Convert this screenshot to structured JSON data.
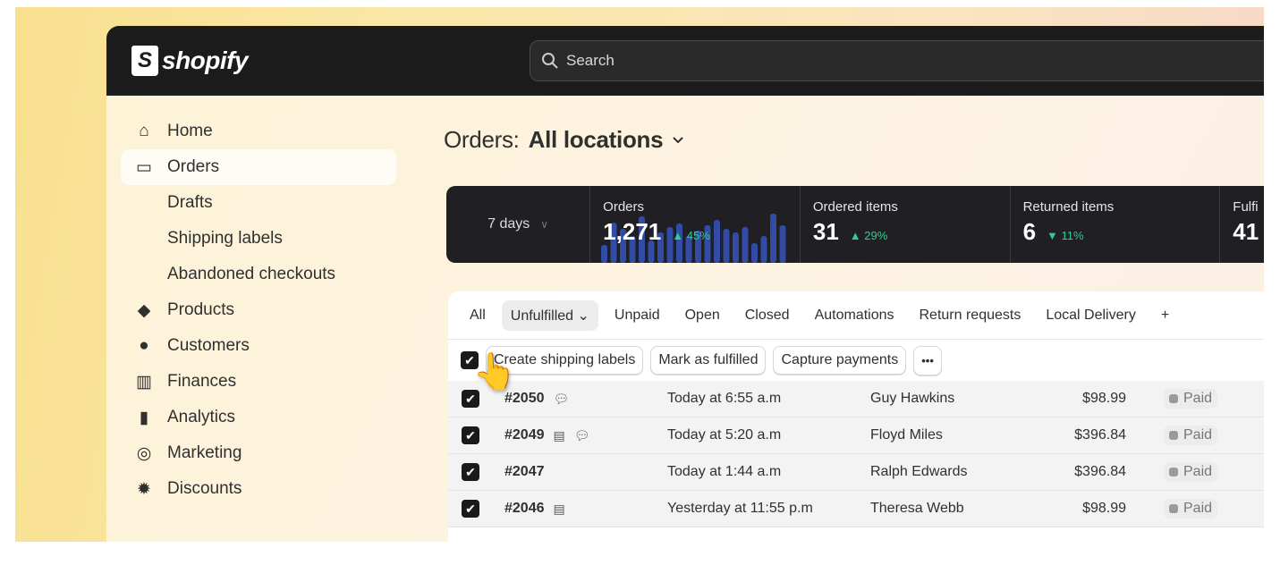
{
  "brand": "shopify",
  "search": {
    "placeholder": "Search"
  },
  "sidebar": {
    "items": [
      {
        "label": "Home",
        "icon": "home-icon"
      },
      {
        "label": "Orders",
        "icon": "inbox-icon",
        "active": true
      },
      {
        "label": "Drafts",
        "sub": true
      },
      {
        "label": "Shipping labels",
        "sub": true
      },
      {
        "label": "Abandoned checkouts",
        "sub": true
      },
      {
        "label": "Products",
        "icon": "tag-icon"
      },
      {
        "label": "Customers",
        "icon": "person-icon"
      },
      {
        "label": "Finances",
        "icon": "bank-icon"
      },
      {
        "label": "Analytics",
        "icon": "bar-chart-icon"
      },
      {
        "label": "Marketing",
        "icon": "target-icon"
      },
      {
        "label": "Discounts",
        "icon": "discount-icon"
      }
    ]
  },
  "page": {
    "title": "Orders:",
    "location": "All locations"
  },
  "stats": {
    "range": "7 days",
    "items": [
      {
        "label": "Orders",
        "value": "1,271",
        "trend": "45%",
        "dir": "up"
      },
      {
        "label": "Ordered items",
        "value": "31",
        "trend": "29%",
        "dir": "up"
      },
      {
        "label": "Returned items",
        "value": "6",
        "trend": "11%",
        "dir": "down"
      },
      {
        "label": "Fulfi",
        "value": "41"
      }
    ]
  },
  "tabs": [
    "All",
    "Unfulfilled",
    "Unpaid",
    "Open",
    "Closed",
    "Automations",
    "Return requests",
    "Local Delivery",
    "+"
  ],
  "bulk": {
    "create": "Create shipping labels",
    "fulfill": "Mark as fulfilled",
    "capture": "Capture payments",
    "more": "•••"
  },
  "orders": [
    {
      "id": "#2050",
      "date": "Today at 6:55 a.m",
      "customer": "Guy Hawkins",
      "total": "$98.99",
      "payment": "Paid",
      "note": false,
      "comment": true
    },
    {
      "id": "#2049",
      "date": "Today at 5:20 a.m",
      "customer": "Floyd Miles",
      "total": "$396.84",
      "payment": "Paid",
      "note": true,
      "comment": true
    },
    {
      "id": "#2047",
      "date": "Today at 1:44 a.m",
      "customer": "Ralph Edwards",
      "total": "$396.84",
      "payment": "Paid",
      "note": false,
      "comment": false
    },
    {
      "id": "#2046",
      "date": "Yesterday at 11:55 p.m",
      "customer": "Theresa Webb",
      "total": "$98.99",
      "payment": "Paid",
      "note": true,
      "comment": false
    }
  ],
  "colors": {
    "trend_up": "#2fcf8f",
    "topbar": "#1c1c1c",
    "spark": "#3a5bd0"
  }
}
